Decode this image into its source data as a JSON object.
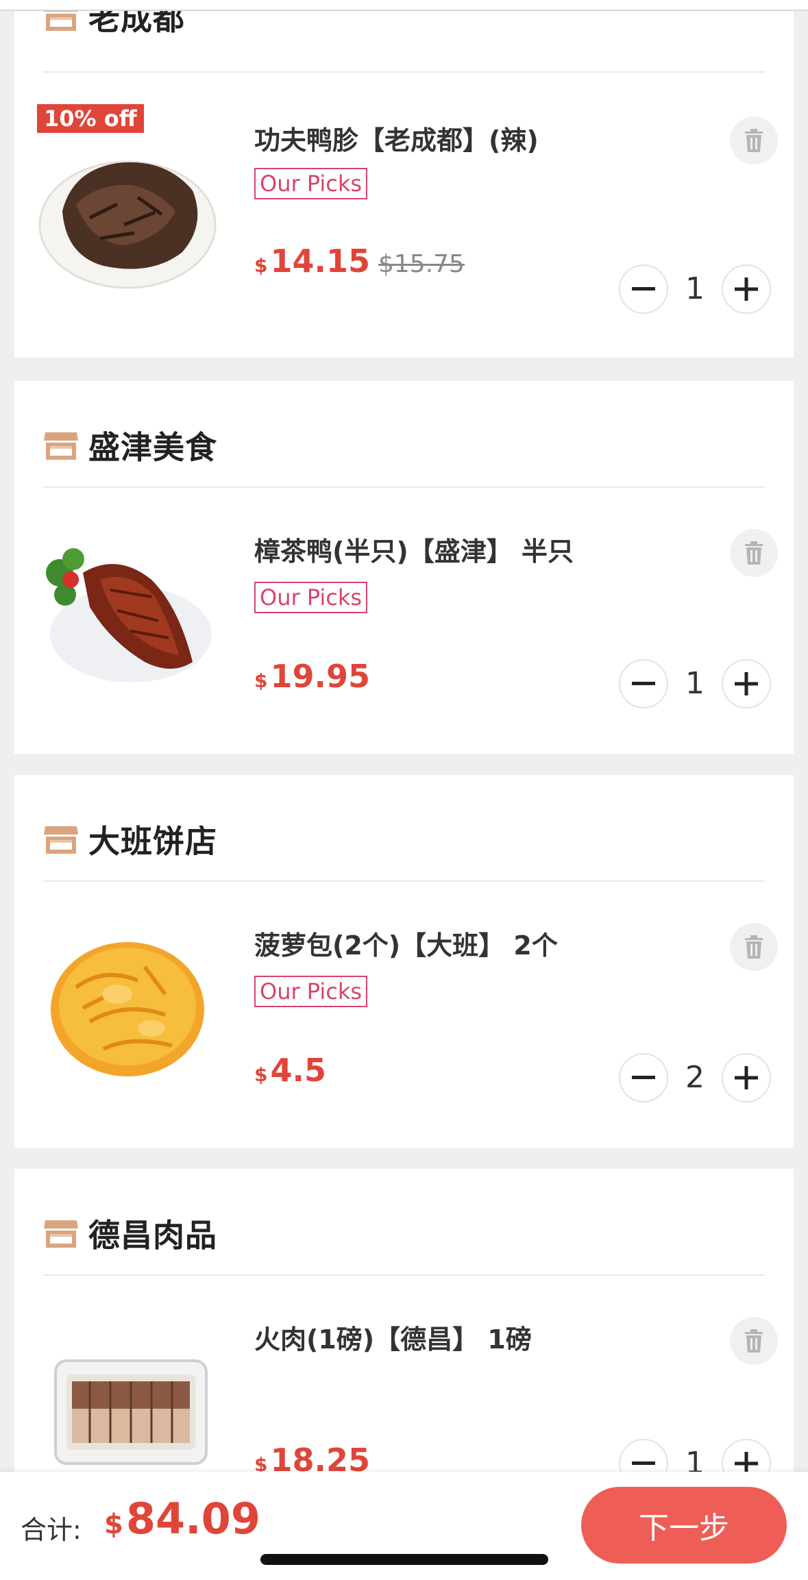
{
  "shops": [
    {
      "name": "老成都",
      "item": {
        "discount": "10% off",
        "name": "功夫鸭胗【老成都】(辣)",
        "badge": "Our Picks",
        "currency": "$",
        "price": "14.15",
        "original_price": "$15.75",
        "quantity": "1",
        "image": "braised-duck-gizzard"
      }
    },
    {
      "name": "盛津美食",
      "item": {
        "name": "樟茶鸭(半只)【盛津】 半只",
        "badge": "Our Picks",
        "currency": "$",
        "price": "19.95",
        "quantity": "1",
        "image": "tea-smoked-duck"
      }
    },
    {
      "name": "大班饼店",
      "item": {
        "name": "菠萝包(2个)【大班】 2个",
        "badge": "Our Picks",
        "currency": "$",
        "price": "4.5",
        "quantity": "2",
        "image": "pineapple-bun"
      }
    },
    {
      "name": "德昌肉品",
      "item": {
        "name": "火肉(1磅)【德昌】 1磅",
        "currency": "$",
        "price": "18.25",
        "quantity": "1",
        "image": "roast-pork-box"
      }
    }
  ],
  "footer": {
    "total_label": "合计:",
    "currency": "$",
    "total": "84.09",
    "next_label": "下一步"
  },
  "colors": {
    "accent": "#e0453a",
    "badge": "#d9436b",
    "next_button": "#ee5e56",
    "store_icon": "#d9a47e"
  },
  "icons": [
    "store-icon",
    "trash-icon",
    "minus-icon",
    "plus-icon"
  ]
}
